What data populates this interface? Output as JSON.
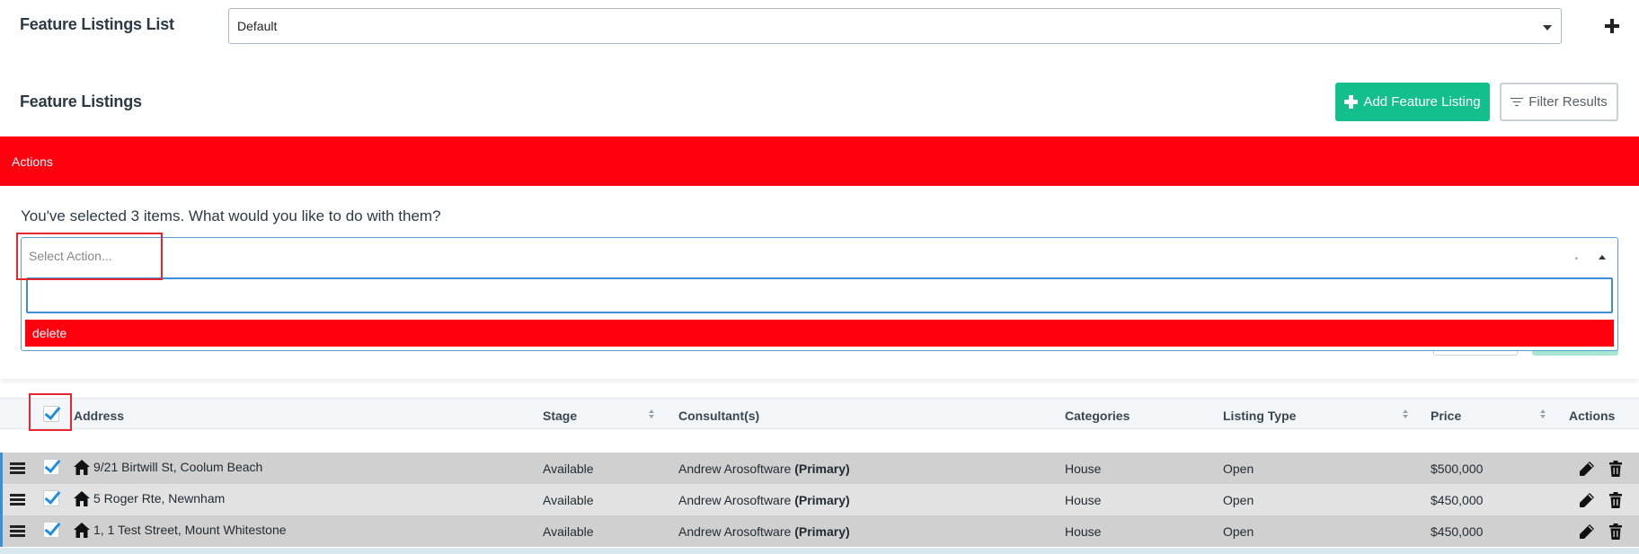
{
  "header": {
    "list_title": "Feature Listings List",
    "list_select_value": "Default",
    "section_title": "Feature Listings",
    "add_button": "Add Feature Listing",
    "filter_button": "Filter Results"
  },
  "actions": {
    "bar_label": "Actions",
    "question": "You've selected 3 items. What would you like to do with them?",
    "select_placeholder": "Select Action...",
    "search_value": "",
    "options": [
      "delete"
    ]
  },
  "table": {
    "columns": {
      "address": "Address",
      "stage": "Stage",
      "consultants": "Consultant(s)",
      "categories": "Categories",
      "listing_type": "Listing Type",
      "price": "Price",
      "actions": "Actions"
    },
    "rows": [
      {
        "address": "9/21 Birtwill St, Coolum Beach",
        "stage": "Available",
        "consultant": "Andrew Arosoftware",
        "consultant_role": "(Primary)",
        "category": "House",
        "listing_type": "Open",
        "price": "$500,000",
        "checked": true
      },
      {
        "address": "5 Roger Rte, Newnham",
        "stage": "Available",
        "consultant": "Andrew Arosoftware",
        "consultant_role": "(Primary)",
        "category": "House",
        "listing_type": "Open",
        "price": "$450,000",
        "checked": true
      },
      {
        "address": "1, 1 Test Street, Mount Whitestone",
        "stage": "Available",
        "consultant": "Andrew Arosoftware",
        "consultant_role": "(Primary)",
        "category": "House",
        "listing_type": "Open",
        "price": "$450,000",
        "checked": true
      }
    ]
  },
  "colors": {
    "accent_green": "#13bf8c",
    "actions_red": "#ff000f",
    "highlight_red": "#e8262f",
    "focus_blue": "#3a8fd6"
  },
  "icons": [
    "plus-icon",
    "filter-icon",
    "caret-down-icon",
    "caret-up-icon",
    "drag-handle-icon",
    "home-icon",
    "edit-icon",
    "trash-icon",
    "checkbox-checked-icon",
    "sort-icon"
  ]
}
